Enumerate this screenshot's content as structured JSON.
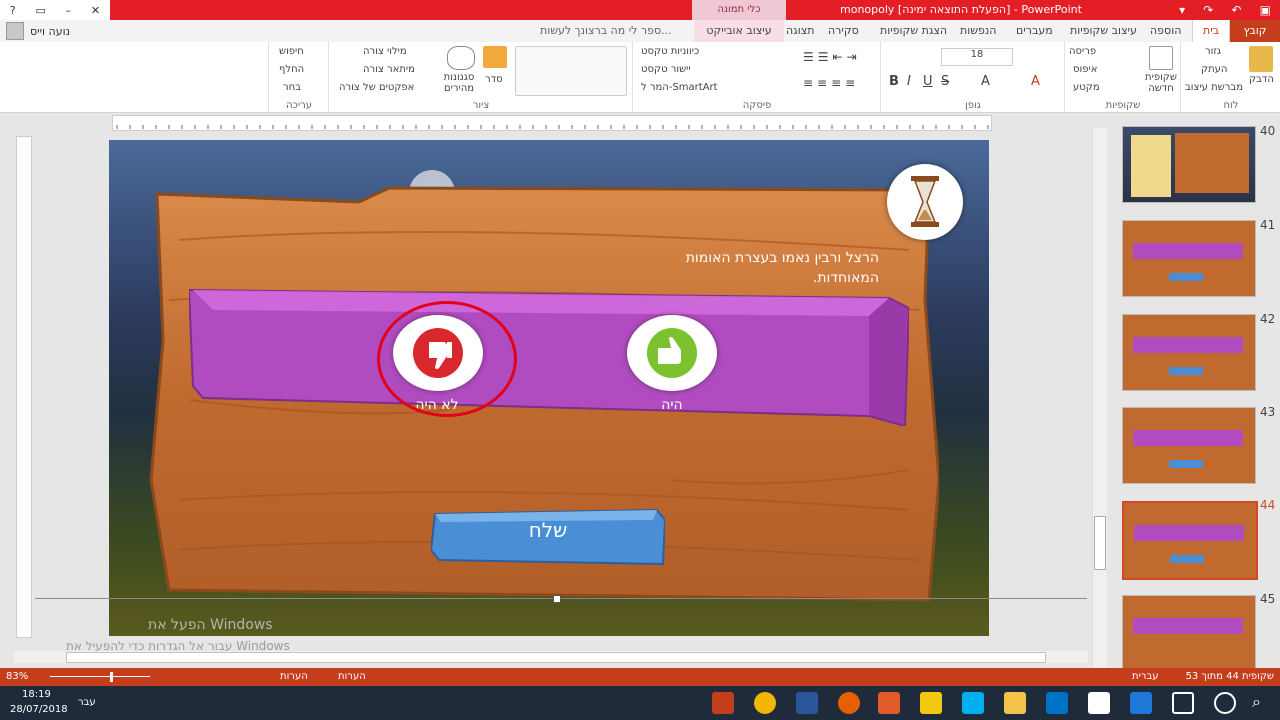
{
  "window": {
    "title": "monopoly [הפעלת התוצאה ימינה] - PowerPoint",
    "context_tab_group": "כלי תמונה",
    "qat_icons": [
      "save-icon",
      "undo-icon",
      "redo-icon",
      "customize-icon"
    ],
    "controls": [
      "help-icon",
      "restore-icon",
      "minimize-icon",
      "close-icon"
    ]
  },
  "user": {
    "name": "נועה וייס"
  },
  "tabs": [
    {
      "label": "קובץ",
      "kind": "file"
    },
    {
      "label": "בית",
      "kind": "selected"
    },
    {
      "label": "הוספה",
      "kind": ""
    },
    {
      "label": "עיצוב שקופיות",
      "kind": ""
    },
    {
      "label": "מעברים",
      "kind": ""
    },
    {
      "label": "הנפשות",
      "kind": ""
    },
    {
      "label": "הצגת שקופיות",
      "kind": ""
    },
    {
      "label": "סקירה",
      "kind": ""
    },
    {
      "label": "תצוגה",
      "kind": ""
    },
    {
      "label": "עיצוב אובייקט",
      "kind": "ctx"
    },
    {
      "label": "ספר לי מה ברצונך לעשות...",
      "kind": ""
    }
  ],
  "ribbon": {
    "groups": [
      "לוח",
      "שקופיות",
      "גופן",
      "פיסקה",
      "ציור",
      "עריכה"
    ],
    "clipboard": {
      "paste": "הדבק",
      "cut": "גזור",
      "copy": "העתק",
      "format_painter": "מברשת עיצוב"
    },
    "slides": {
      "new_slide": "שקופית חדשה",
      "layout": "פריסה",
      "reset": "איפוס",
      "section": "מקטע"
    },
    "font": {
      "size": "18"
    },
    "paragraph": {
      "text_direction": "כיווניות טקסט",
      "align_text": "יישור טקסט",
      "smartart": "המר ל-SmartArt"
    },
    "drawing": {
      "arrange": "סדר",
      "quick_styles": "סגנונות מהירים",
      "shape_fill": "מילוי צורה",
      "shape_outline": "מיתאר צורה",
      "shape_effects": "אפקטים של צורה"
    },
    "editing": {
      "find": "חיפוש",
      "replace": "החלף",
      "select": "בחר"
    }
  },
  "slide": {
    "question": "הרצל ורבין נאמו בעצרת האומות המאוחדות.",
    "answer_false": "לא היה",
    "answer_true": "היה",
    "send": "שלח",
    "colors": {
      "board": "#c8743a",
      "purple": "#b04cc0",
      "red": "#d9272e",
      "green": "#7cc12e",
      "blue": "#4a8ed6"
    }
  },
  "watermark": {
    "line1": "הפעל את Windows",
    "line2": "עבור אל הגדרות כדי להפעיל את Windows"
  },
  "thumbnails": [
    {
      "num": "40",
      "selected": false
    },
    {
      "num": "41",
      "selected": false
    },
    {
      "num": "42",
      "selected": false
    },
    {
      "num": "43",
      "selected": false
    },
    {
      "num": "44",
      "selected": true
    },
    {
      "num": "45",
      "selected": false
    }
  ],
  "statusbar": {
    "slide_info": "שקופית 44 מתוך 53",
    "language": "עברית",
    "notes": "הערות",
    "comments": "הערות",
    "zoom": "83%"
  },
  "taskbar": {
    "time": "18:19",
    "date": "28/07/2018",
    "lang": "עבר"
  }
}
